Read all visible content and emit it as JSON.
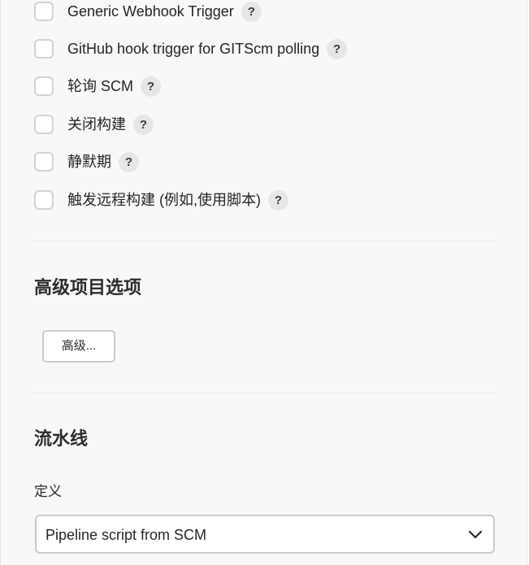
{
  "triggers": {
    "items": [
      {
        "label": "Generic Webhook Trigger",
        "help": "?",
        "checked": false
      },
      {
        "label": "GitHub hook trigger for GITScm polling",
        "help": "?",
        "checked": false
      },
      {
        "label": "轮询 SCM",
        "help": "?",
        "checked": false
      },
      {
        "label": "关闭构建",
        "help": "?",
        "checked": false
      },
      {
        "label": "静默期",
        "help": "?",
        "checked": false
      },
      {
        "label": "触发远程构建 (例如,使用脚本)",
        "help": "?",
        "checked": false
      }
    ]
  },
  "advanced_options": {
    "title": "高级项目选项",
    "button_label": "高级..."
  },
  "pipeline": {
    "title": "流水线",
    "definition_label": "定义",
    "definition_value": "Pipeline script from SCM"
  },
  "colors": {
    "background": "#f8f8f8",
    "checkbox_border": "#d0d3d6",
    "help_badge": "#e6e6e6"
  },
  "icons": {
    "help": "question-mark",
    "select_arrow": "chevron-down"
  }
}
